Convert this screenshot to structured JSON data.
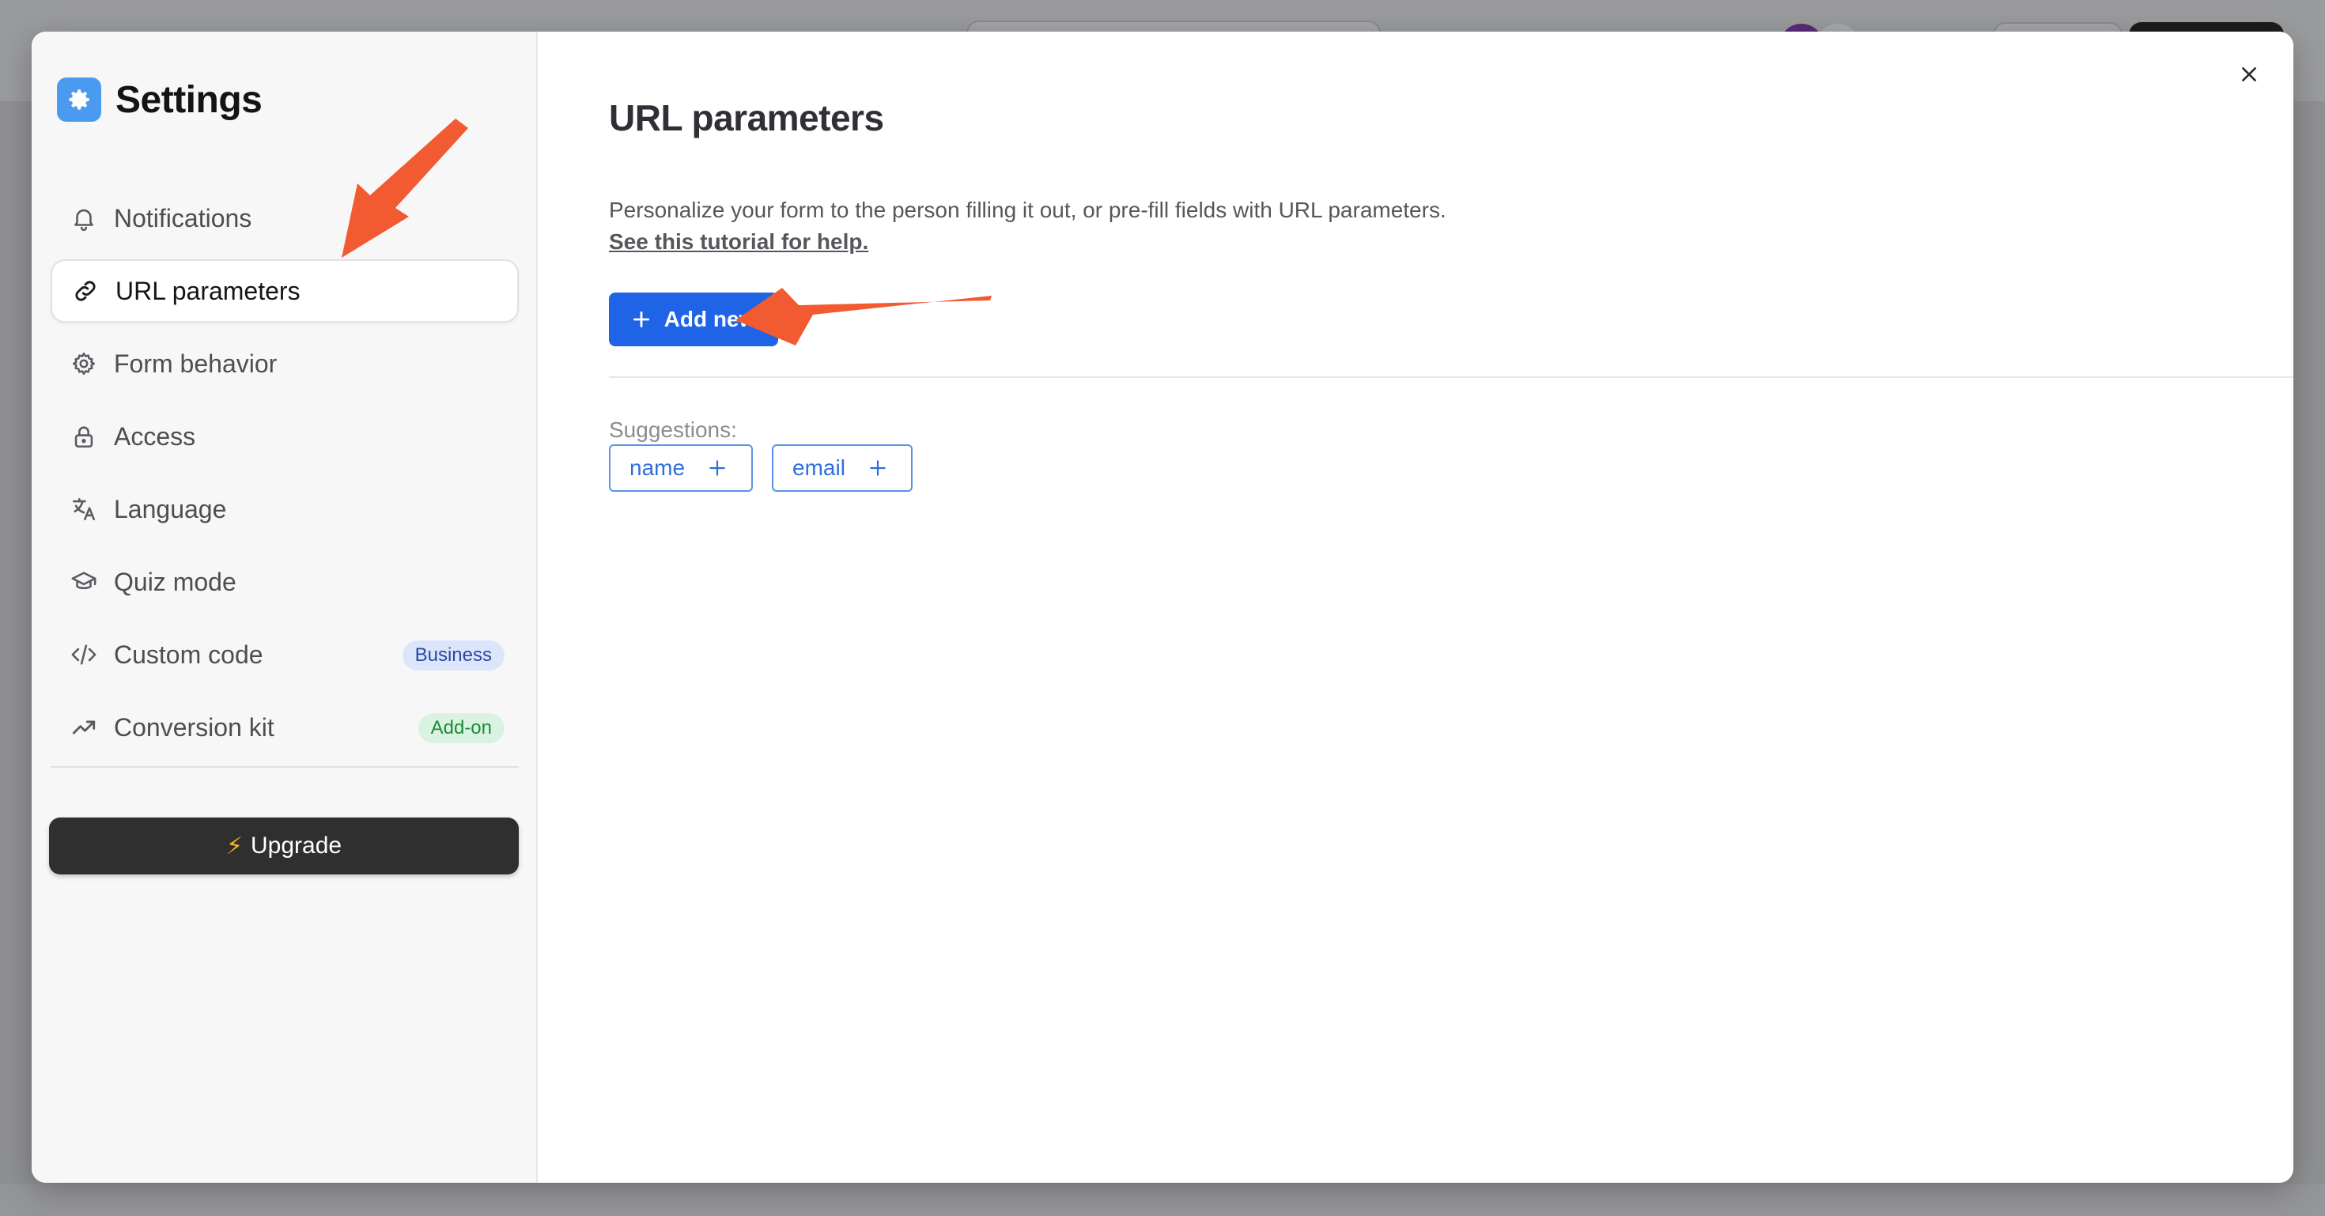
{
  "settings": {
    "title": "Settings"
  },
  "nav": {
    "items": [
      {
        "label": "Notifications"
      },
      {
        "label": "URL parameters"
      },
      {
        "label": "Form behavior"
      },
      {
        "label": "Access"
      },
      {
        "label": "Language"
      },
      {
        "label": "Quiz mode"
      },
      {
        "label": "Custom code",
        "badge": "Business"
      },
      {
        "label": "Conversion kit",
        "badge": "Add-on"
      }
    ],
    "active": "URL parameters"
  },
  "upgrade": {
    "label": "Upgrade"
  },
  "main": {
    "title": "URL parameters",
    "description": "Personalize your form to the person filling it out, or pre-fill fields with URL parameters.",
    "tutorial_link": "See this tutorial for help.",
    "add_button": "Add new",
    "suggestions_label": "Suggestions:",
    "suggestions": [
      {
        "label": "name"
      },
      {
        "label": "email"
      }
    ]
  },
  "colors": {
    "accent": "#1f63e6",
    "annotation_arrow": "#f25a32",
    "business_badge_bg": "#dce6fb",
    "addon_badge_bg": "#daf3e0",
    "upgrade_bg": "#2f2f2f"
  },
  "icons": {
    "close": "close-icon",
    "settings_logo": "gear-icon"
  }
}
